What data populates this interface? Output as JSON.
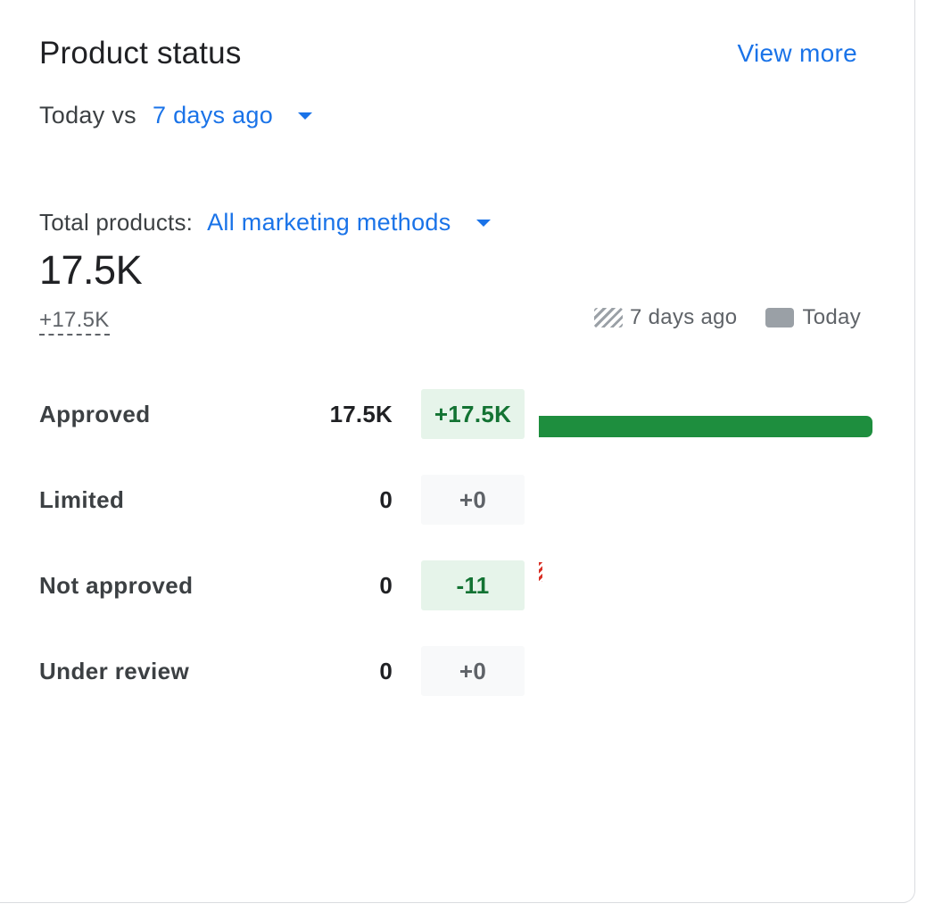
{
  "header": {
    "title": "Product status",
    "view_more": "View more"
  },
  "comparison": {
    "prefix": "Today vs",
    "period": "7 days ago"
  },
  "totals": {
    "label": "Total products:",
    "filter": "All marketing methods",
    "value": "17.5K",
    "delta": "+17.5K"
  },
  "legend": {
    "previous": "7 days ago",
    "current": "Today"
  },
  "statuses": [
    {
      "label": "Approved",
      "count": "17.5K",
      "delta": "+17.5K",
      "delta_style": "positive",
      "bar_fraction": 1.0,
      "prev_fraction": 0
    },
    {
      "label": "Limited",
      "count": "0",
      "delta": "+0",
      "delta_style": "neutral",
      "bar_fraction": 0,
      "prev_fraction": 0
    },
    {
      "label": "Not approved",
      "count": "0",
      "delta": "-11",
      "delta_style": "positive",
      "bar_fraction": 0,
      "prev_fraction": 0.01
    },
    {
      "label": "Under review",
      "count": "0",
      "delta": "+0",
      "delta_style": "neutral",
      "bar_fraction": 0,
      "prev_fraction": 0
    }
  ],
  "colors": {
    "accent": "#1a73e8",
    "bar_current": "#1e8e3e",
    "bar_previous_negative": "#d93025",
    "delta_positive_bg": "#e6f4ea",
    "delta_positive_text": "#137333",
    "delta_neutral_bg": "#f8f9fa",
    "delta_neutral_text": "#5f6368"
  },
  "icons": {
    "dropdown": "caret-down-icon",
    "legend_previous": "hatched-swatch-icon",
    "legend_current": "solid-swatch-icon"
  }
}
